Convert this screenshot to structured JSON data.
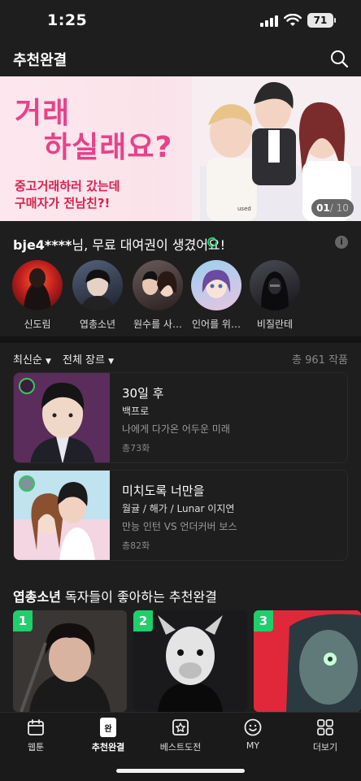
{
  "status_bar": {
    "time": "1:25",
    "battery": "71"
  },
  "header": {
    "title": "추천완결"
  },
  "banner": {
    "headline_line1": "거래",
    "headline_line2": "하실래요?",
    "subline1": "중고거래하러 갔는데",
    "subline2": "구매자가 전남친?!",
    "page_current": "01",
    "page_total": "/ 10",
    "art_label": "used"
  },
  "rental": {
    "user": "bje4****",
    "message": "님, 무료 대여권이 생겼어요!",
    "info_glyph": "i",
    "items": [
      {
        "label": "신도림"
      },
      {
        "label": "엽총소년"
      },
      {
        "label": "원수를 사…"
      },
      {
        "label": "인어를 위…"
      },
      {
        "label": "비질란테"
      }
    ]
  },
  "filter": {
    "sort_label": "최신순",
    "genre_label": "전체 장르",
    "count_text": "총 961 작품"
  },
  "list": [
    {
      "title": "30일 후",
      "author": "백프로",
      "desc": "나에게 다가온 어두운 미래",
      "episodes": "총73화"
    },
    {
      "title": "미치도록 너만을",
      "author": "월귤 / 해가 / Lunar 이지연",
      "desc": "만능 인턴 VS 언더커버 보스",
      "episodes": "총82화"
    }
  ],
  "recommended": {
    "title_bold": "엽총소년",
    "title_rest": " 독자들이 좋아하는 추천완결",
    "ranks": [
      "1",
      "2",
      "3"
    ]
  },
  "tabbar": {
    "items": [
      {
        "label": "웹툰",
        "icon": "calendar-icon"
      },
      {
        "label": "추천완결",
        "icon": "book-complete-icon",
        "badge": "완"
      },
      {
        "label": "베스트도전",
        "icon": "star-challenge-icon"
      },
      {
        "label": "MY",
        "icon": "smile-icon"
      },
      {
        "label": "더보기",
        "icon": "grid-icon"
      }
    ]
  },
  "colors": {
    "accent_green": "#1fcf6b",
    "banner_pink": "#e8418a",
    "background": "#1e1e1e"
  }
}
